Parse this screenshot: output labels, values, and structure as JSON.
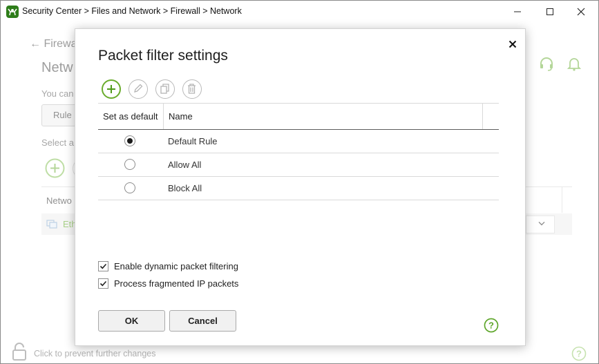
{
  "window": {
    "title": "Security Center > Files and Network > Firewall > Network"
  },
  "background": {
    "back_link": "Firewa",
    "heading": "Netw",
    "intro_text": "You can",
    "rule_button": "Rule",
    "select_text": "Select a",
    "column_header": "Netwo",
    "row_name": "Eth",
    "lock_text": "Click to prevent further changes"
  },
  "dialog": {
    "title": "Packet filter settings",
    "toolbar": {
      "add_icon": "plus-icon",
      "edit_icon": "pencil-icon",
      "copy_icon": "copy-icon",
      "delete_icon": "trash-icon"
    },
    "table": {
      "headers": [
        "Set as default",
        "Name"
      ],
      "rows": [
        {
          "default": true,
          "name": "Default Rule"
        },
        {
          "default": false,
          "name": "Allow All"
        },
        {
          "default": false,
          "name": "Block All"
        }
      ]
    },
    "options": [
      {
        "checked": true,
        "label": "Enable dynamic packet filtering"
      },
      {
        "checked": true,
        "label": "Process fragmented IP packets"
      }
    ],
    "buttons": {
      "ok": "OK",
      "cancel": "Cancel"
    }
  },
  "colors": {
    "accent": "#6aac2d",
    "dim_text": "#6b6b6b"
  }
}
